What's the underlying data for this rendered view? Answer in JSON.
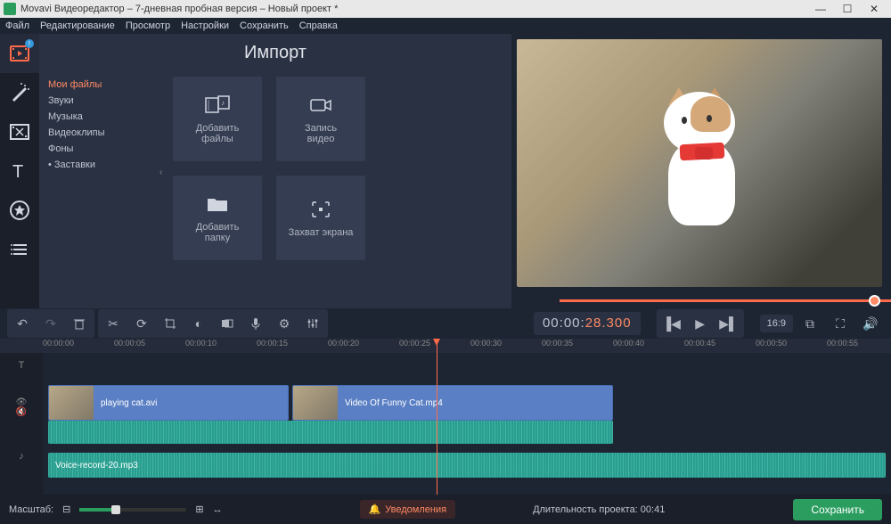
{
  "window": {
    "title": "Movavi Видеоредактор – 7-дневная пробная версия – Новый проект *"
  },
  "menu": {
    "file": "Файл",
    "edit": "Редактирование",
    "view": "Просмотр",
    "settings": "Настройки",
    "save": "Сохранить",
    "help": "Справка"
  },
  "import": {
    "title": "Импорт",
    "categories": [
      "Мои файлы",
      "Звуки",
      "Музыка",
      "Видеоклипы",
      "Фоны",
      "• Заставки"
    ],
    "tiles": {
      "addfiles": "Добавить\nфайлы",
      "recvideo": "Запись\nвидео",
      "addfolder": "Добавить\nпапку",
      "screencap": "Захват экрана"
    }
  },
  "help_q": "?",
  "preview": {
    "timecode_gray": "00:00:",
    "timecode_orange": "28.300",
    "ratio": "16:9"
  },
  "ruler": [
    "00:00:00",
    "00:00:05",
    "00:00:10",
    "00:00:15",
    "00:00:20",
    "00:00:25",
    "00:00:30",
    "00:00:35",
    "00:00:40",
    "00:00:45",
    "00:00:50",
    "00:00:55"
  ],
  "clips": {
    "v1": "playing cat.avi",
    "v2": "Video Of Funny Cat.mp4",
    "a1": "Voice-record-20.mp3"
  },
  "bottom": {
    "scale": "Масштаб:",
    "notif": "Уведомления",
    "duration": "Длительность проекта:   00:41",
    "save": "Сохранить"
  }
}
